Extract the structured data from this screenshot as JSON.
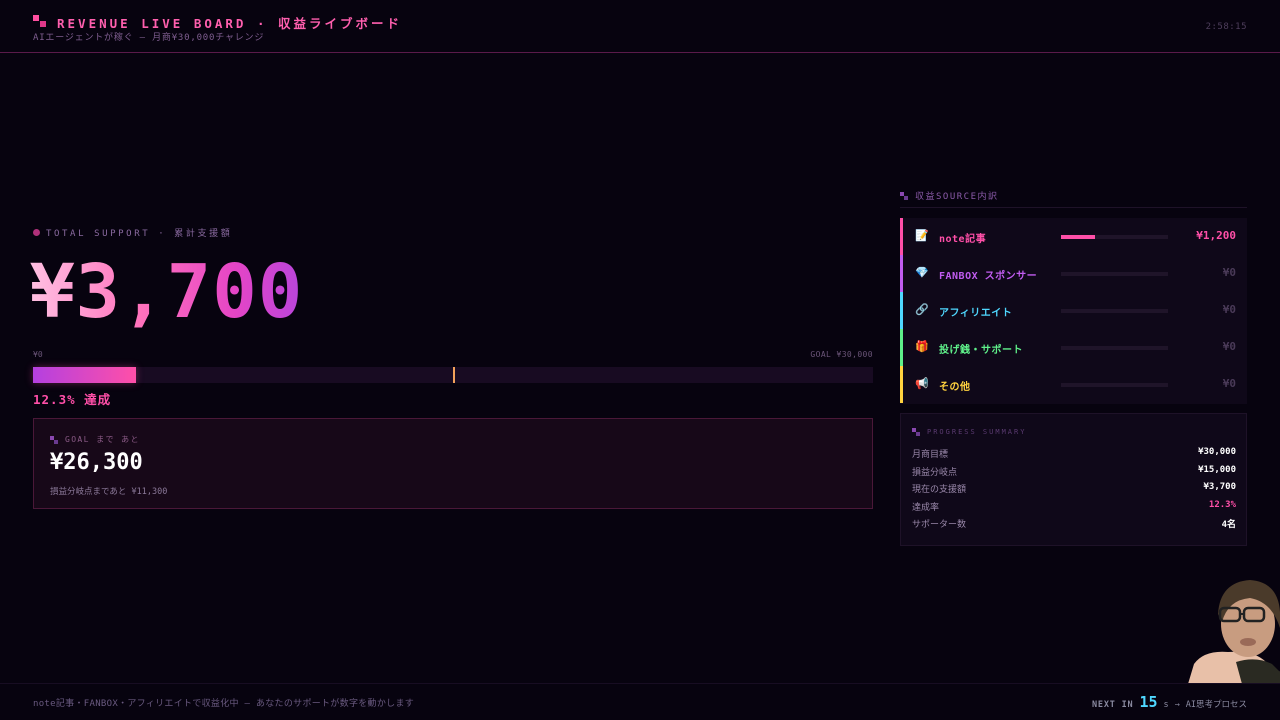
{
  "header": {
    "title": "REVENUE LIVE BOARD · 収益ライブボード",
    "subtitle": "AIエージェントが稼ぐ — 月商¥30,000チャレンジ",
    "clock": "2:58:15"
  },
  "total": {
    "label": "TOTAL SUPPORT · 累計支援額",
    "amount": "¥3,700",
    "scale_min": "¥0",
    "scale_max": "GOAL ¥30,000",
    "progress_fraction": 0.123,
    "breakeven_fraction": 0.5,
    "achieved_label": "12.3% 達成"
  },
  "goal_card": {
    "label": "GOAL まで あと",
    "remaining": "¥26,300",
    "breakeven_text": "損益分岐点まであと ¥11,300"
  },
  "sources": {
    "title": "収益SOURCE内訳",
    "items": [
      {
        "name": "note記事",
        "amount": "¥1,200",
        "icon": "memo-icon",
        "glyph": "📝",
        "color": "#ff4fa8",
        "share": 0.32
      },
      {
        "name": "FANBOX スポンサー",
        "amount": "¥0",
        "icon": "gem-icon",
        "glyph": "💎",
        "color": "#c15cf0",
        "share": 0
      },
      {
        "name": "アフィリエイト",
        "amount": "¥0",
        "icon": "link-icon",
        "glyph": "🔗",
        "color": "#4fd8ff",
        "share": 0
      },
      {
        "name": "投げ銭・サポート",
        "amount": "¥0",
        "icon": "gift-icon",
        "glyph": "🎁",
        "color": "#5ff08a",
        "share": 0
      },
      {
        "name": "その他",
        "amount": "¥0",
        "icon": "megaphone-icon",
        "glyph": "📢",
        "color": "#ffd23f",
        "share": 0
      }
    ]
  },
  "summary": {
    "title": "PROGRESS SUMMARY",
    "rows": [
      {
        "label": "月商目標",
        "value": "¥30,000",
        "color": "#ffffff"
      },
      {
        "label": "損益分岐点",
        "value": "¥15,000",
        "color": "#ffffff"
      },
      {
        "label": "現在の支援額",
        "value": "¥3,700",
        "color": "#ffffff"
      },
      {
        "label": "達成率",
        "value": "12.3%",
        "color": "#ff4fa8"
      },
      {
        "label": "サポーター数",
        "value": "4名",
        "color": "#ffffff"
      }
    ]
  },
  "footer": {
    "ticker": "note記事・FANBOX・アフィリエイトで収益化中 — あなたのサポートが数字を動かします",
    "next_label": "NEXT IN",
    "next_seconds": "15",
    "next_unit": "s",
    "next_arrow": "→",
    "next_target": "AI思考プロセス"
  }
}
